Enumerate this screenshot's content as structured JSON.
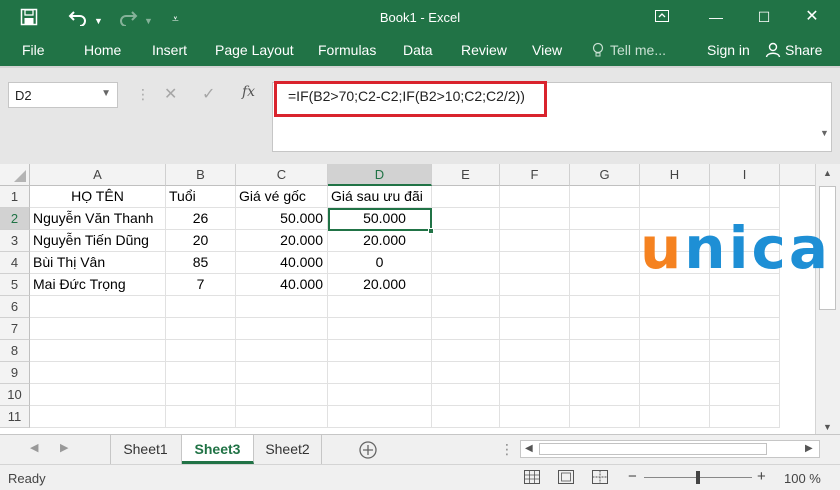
{
  "window": {
    "title": "Book1 - Excel"
  },
  "menu": {
    "file": "File",
    "home": "Home",
    "insert": "Insert",
    "page_layout": "Page Layout",
    "formulas": "Formulas",
    "data": "Data",
    "review": "Review",
    "view": "View",
    "tell_me": "Tell me...",
    "sign_in": "Sign in",
    "share": "Share"
  },
  "formula_bar": {
    "name_box": "D2",
    "fx_label": "fx",
    "formula": "=IF(B2>70;C2-C2;IF(B2>10;C2;C2/2))"
  },
  "sheet": {
    "columns": [
      "A",
      "B",
      "C",
      "D",
      "E",
      "F",
      "G",
      "H",
      "I"
    ],
    "row_numbers": [
      "1",
      "2",
      "3",
      "4",
      "5",
      "6",
      "7",
      "8",
      "9",
      "10",
      "11"
    ],
    "selected_column": "D",
    "selected_row": "2",
    "active_cell": "D2",
    "rows": [
      [
        "HỌ TÊN",
        "Tuổi",
        "Giá vé gốc",
        "Giá sau ưu đãi"
      ],
      [
        "Nguyễn Văn Thanh",
        "26",
        "50.000",
        "50.000"
      ],
      [
        "Nguyễn Tiến Dũng",
        "20",
        "20.000",
        "20.000"
      ],
      [
        "Bùi Thị Vân",
        "85",
        "40.000",
        "0"
      ],
      [
        "Mai Đức Trọng",
        "7",
        "40.000",
        "20.000"
      ]
    ]
  },
  "tabs": [
    "Sheet1",
    "Sheet3",
    "Sheet2"
  ],
  "active_tab": "Sheet3",
  "status": {
    "ready": "Ready",
    "zoom": "100 %"
  },
  "watermark": {
    "text": "unica",
    "colors": {
      "u": "#f58220",
      "rest": "#1e8fd5"
    }
  },
  "colors": {
    "excel_green": "#217346",
    "highlight_red": "#d9232d"
  }
}
